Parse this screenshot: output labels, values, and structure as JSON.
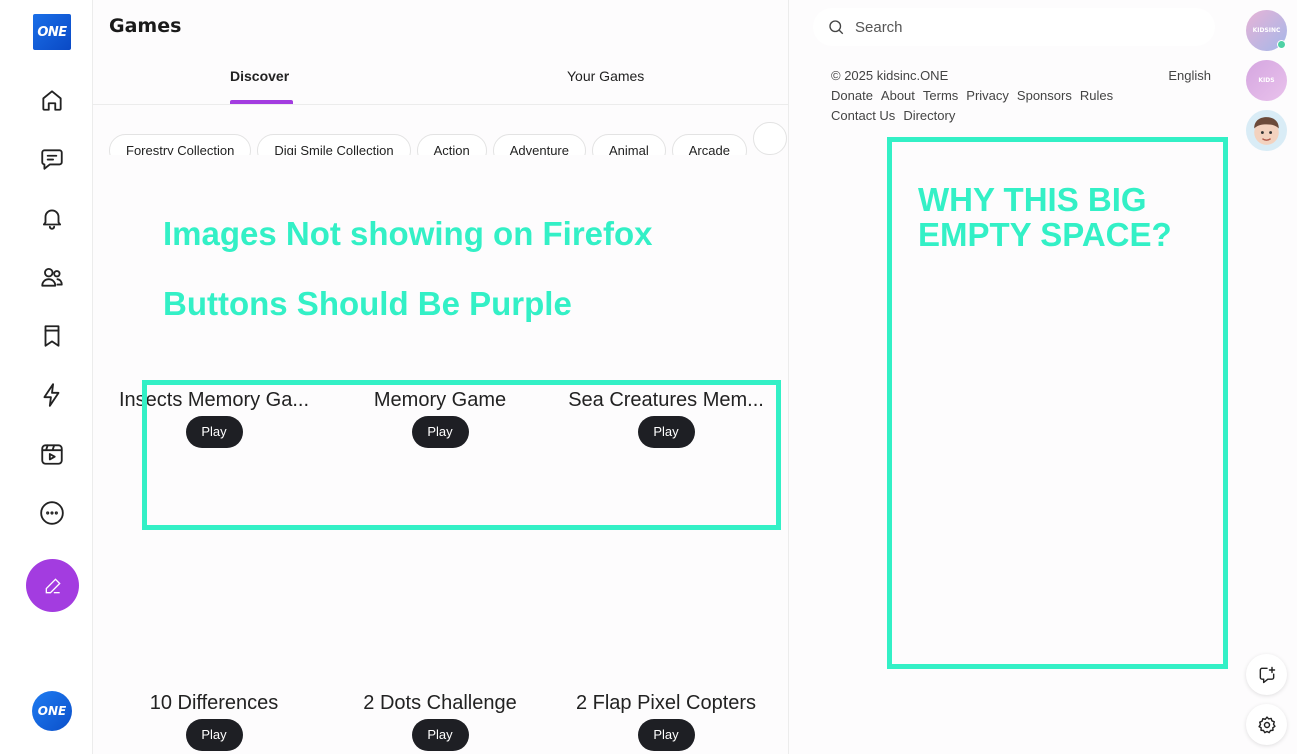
{
  "app": {
    "logo_text": "ONE",
    "avatar_text": "ONE"
  },
  "rail": {
    "icons": [
      "home-icon",
      "chat-icon",
      "bell-icon",
      "users-icon",
      "bookmark-icon",
      "lightning-icon",
      "video-icon",
      "more-icon"
    ],
    "compose_icon": "pencil-icon",
    "accent": "#a33ce0"
  },
  "main": {
    "title": "Games",
    "tabs": [
      {
        "label": "Discover",
        "active": true
      },
      {
        "label": "Your Games",
        "active": false
      }
    ],
    "chips": [
      "Forestry Collection",
      "Digi Smile Collection",
      "Action",
      "Adventure",
      "Animal",
      "Arcade",
      ""
    ],
    "games": [
      {
        "title": "Insects Memory Ga...",
        "button": "Play"
      },
      {
        "title": "Memory Game",
        "button": "Play"
      },
      {
        "title": "Sea Creatures Mem...",
        "button": "Play"
      },
      {
        "title": "10 Differences",
        "button": "Play"
      },
      {
        "title": "2 Dots Challenge",
        "button": "Play"
      },
      {
        "title": "2 Flap Pixel Copters",
        "button": "Play"
      }
    ]
  },
  "annotations": {
    "images_note": "Images Not showing on Firefox",
    "buttons_note": "Buttons Should Be Purple",
    "space_note": "WHY THIS BIG EMPTY SPACE?",
    "color": "#33f0c6"
  },
  "right": {
    "search_placeholder": "Search",
    "copyright": "© 2025 kidsinc.ONE",
    "language": "English",
    "links_row1": [
      "Donate",
      "About",
      "Terms",
      "Privacy",
      "Sponsors",
      "Rules"
    ],
    "links_row2": [
      "Contact Us",
      "Directory"
    ],
    "avatar1_text": "KIDSINC",
    "avatar2_text": "KIDS"
  }
}
